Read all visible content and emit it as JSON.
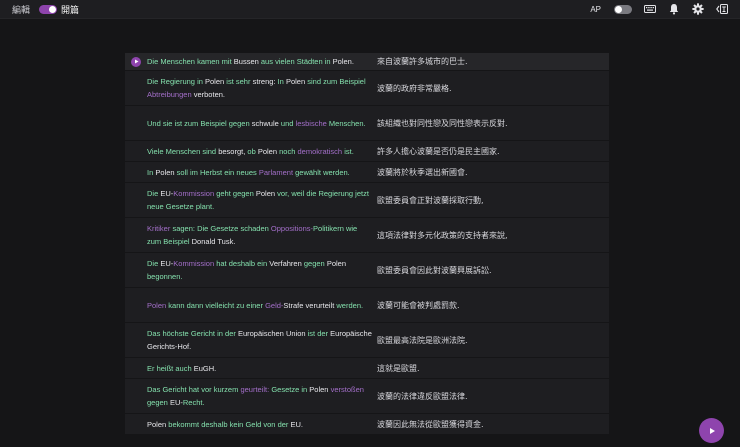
{
  "topbar": {
    "edit_label": "編輯",
    "layout_label": "開篇",
    "ap_label": "AP"
  },
  "colors": {
    "accent": "#8e44ad",
    "word_green": "#84e0ad",
    "word_purple": "#a36fc9",
    "word_plain": "#e8e8ec"
  },
  "rows": [
    {
      "words": [
        [
          "Die",
          "g"
        ],
        [
          "Menschen",
          "g"
        ],
        [
          "kamen",
          "g"
        ],
        [
          "mit",
          "g"
        ],
        [
          "Bussen",
          "f"
        ],
        [
          "aus",
          "g"
        ],
        [
          "vielen",
          "g"
        ],
        [
          "Städten",
          "g"
        ],
        [
          "in",
          "g"
        ],
        [
          "Polen.",
          "f"
        ]
      ],
      "zh": "來自波蘭許多城市的巴士."
    },
    {
      "words": [
        [
          "Die",
          "g"
        ],
        [
          "Regierung",
          "g"
        ],
        [
          "in",
          "g"
        ],
        [
          "Polen",
          "f"
        ],
        [
          "ist",
          "g"
        ],
        [
          "sehr",
          "g"
        ],
        [
          "streng:",
          "f"
        ],
        [
          "In",
          "g"
        ],
        [
          "Polen",
          "f"
        ],
        [
          "sind",
          "g"
        ],
        [
          "zum",
          "g"
        ],
        [
          "Beispiel",
          "g"
        ],
        [
          "Abtreibungen",
          "p"
        ],
        [
          "verboten.",
          "f"
        ]
      ],
      "zh": "波蘭的政府非常嚴格."
    },
    {
      "words": [
        [
          "Und",
          "g"
        ],
        [
          "sie",
          "g"
        ],
        [
          "ist",
          "g"
        ],
        [
          "zum",
          "g"
        ],
        [
          "Beispiel",
          "g"
        ],
        [
          "gegen",
          "g"
        ],
        [
          "schwule",
          "f"
        ],
        [
          "und",
          "g"
        ],
        [
          "lesbische",
          "p"
        ],
        [
          "Menschen.",
          "g"
        ]
      ],
      "zh": "該組織也對同性戀及同性戀表示反對."
    },
    {
      "words": [
        [
          "Viele",
          "g"
        ],
        [
          "Menschen",
          "g"
        ],
        [
          "sind",
          "g"
        ],
        [
          "besorgt,",
          "f"
        ],
        [
          "ob",
          "g"
        ],
        [
          "Polen",
          "f"
        ],
        [
          "noch",
          "g"
        ],
        [
          "demokratisch",
          "p"
        ],
        [
          "ist.",
          "g"
        ]
      ],
      "zh": "許多人擔心波蘭是否仍是民主國家."
    },
    {
      "words": [
        [
          "In",
          "g"
        ],
        [
          "Polen",
          "f"
        ],
        [
          "soll",
          "g"
        ],
        [
          "im",
          "g"
        ],
        [
          "Herbst",
          "g"
        ],
        [
          "ein",
          "g"
        ],
        [
          "neues",
          "g"
        ],
        [
          "Parlament",
          "p"
        ],
        [
          "gewählt",
          "g"
        ],
        [
          "werden.",
          "g"
        ]
      ],
      "zh": "波蘭將於秋季選出新國會."
    },
    {
      "words": [
        [
          "Die",
          "g"
        ],
        [
          "EU-",
          "f"
        ],
        [
          "Kommission",
          "p"
        ],
        [
          "geht",
          "g"
        ],
        [
          "gegen",
          "g"
        ],
        [
          "Polen",
          "f"
        ],
        [
          "vor,",
          "g"
        ],
        [
          "weil",
          "g"
        ],
        [
          "die",
          "g"
        ],
        [
          "Regierung",
          "g"
        ],
        [
          "jetzt",
          "g"
        ],
        [
          "neue",
          "g"
        ],
        [
          "Gesetze",
          "g"
        ],
        [
          "plant.",
          "g"
        ]
      ],
      "zh": "歐盟委員會正對波蘭採取行動,"
    },
    {
      "words": [
        [
          "Kritiker",
          "p"
        ],
        [
          "sagen:",
          "g"
        ],
        [
          "Die",
          "g"
        ],
        [
          "Gesetze",
          "g"
        ],
        [
          "schaden",
          "g"
        ],
        [
          "Oppositions-",
          "p"
        ],
        [
          "Politikern",
          "g"
        ],
        [
          "wie",
          "g"
        ],
        [
          "zum",
          "g"
        ],
        [
          "Beispiel",
          "g"
        ],
        [
          "Donald",
          "f"
        ],
        [
          "Tusk.",
          "f"
        ]
      ],
      "zh": "這項法律對多元化政策的支持者來說,"
    },
    {
      "words": [
        [
          "Die",
          "g"
        ],
        [
          "EU-",
          "f"
        ],
        [
          "Kommission",
          "p"
        ],
        [
          "hat",
          "g"
        ],
        [
          "deshalb",
          "g"
        ],
        [
          "ein",
          "g"
        ],
        [
          "Verfahren",
          "f"
        ],
        [
          "gegen",
          "g"
        ],
        [
          "Polen",
          "f"
        ],
        [
          "begonnen.",
          "g"
        ]
      ],
      "zh": "歐盟委員會因此對波蘭興展訴訟."
    },
    {
      "words": [
        [
          "Polen",
          "p"
        ],
        [
          "kann",
          "g"
        ],
        [
          "dann",
          "g"
        ],
        [
          "vielleicht",
          "g"
        ],
        [
          "zu",
          "g"
        ],
        [
          "einer",
          "g"
        ],
        [
          "Geld-",
          "p"
        ],
        [
          "Strafe",
          "f"
        ],
        [
          "verurteilt",
          "f"
        ],
        [
          "werden.",
          "g"
        ]
      ],
      "zh": "波蘭可能會被判處罰款."
    },
    {
      "words": [
        [
          "Das",
          "g"
        ],
        [
          "höchste",
          "g"
        ],
        [
          "Gericht",
          "g"
        ],
        [
          "in",
          "g"
        ],
        [
          "der",
          "g"
        ],
        [
          "Europäischen",
          "f"
        ],
        [
          "Union",
          "f"
        ],
        [
          "ist",
          "g"
        ],
        [
          "der",
          "g"
        ],
        [
          "Europäische",
          "f"
        ],
        [
          "Gerichts-",
          "f"
        ],
        [
          "Hof.",
          "f"
        ]
      ],
      "zh": "歐盟最高法院是歐洲法院."
    },
    {
      "words": [
        [
          "Er",
          "g"
        ],
        [
          "heißt",
          "g"
        ],
        [
          "auch",
          "g"
        ],
        [
          "EuGH.",
          "f"
        ]
      ],
      "zh": "這就是歐盟."
    },
    {
      "words": [
        [
          "Das",
          "g"
        ],
        [
          "Gericht",
          "g"
        ],
        [
          "hat",
          "g"
        ],
        [
          "vor",
          "g"
        ],
        [
          "kurzem",
          "g"
        ],
        [
          "geurteilt:",
          "p"
        ],
        [
          "Gesetze",
          "g"
        ],
        [
          "in",
          "g"
        ],
        [
          "Polen",
          "f"
        ],
        [
          "verstoßen",
          "p"
        ],
        [
          "gegen",
          "g"
        ],
        [
          "EU-",
          "f"
        ],
        [
          "Recht.",
          "g"
        ]
      ],
      "zh": "波蘭的法律違反歐盟法律."
    },
    {
      "words": [
        [
          "Polen",
          "f"
        ],
        [
          "bekommt",
          "g"
        ],
        [
          "deshalb",
          "g"
        ],
        [
          "kein",
          "g"
        ],
        [
          "Geld",
          "g"
        ],
        [
          "von",
          "g"
        ],
        [
          "der",
          "g"
        ],
        [
          "EU.",
          "f"
        ]
      ],
      "zh": "波蘭因此無法從歐盟獲得資金."
    }
  ]
}
